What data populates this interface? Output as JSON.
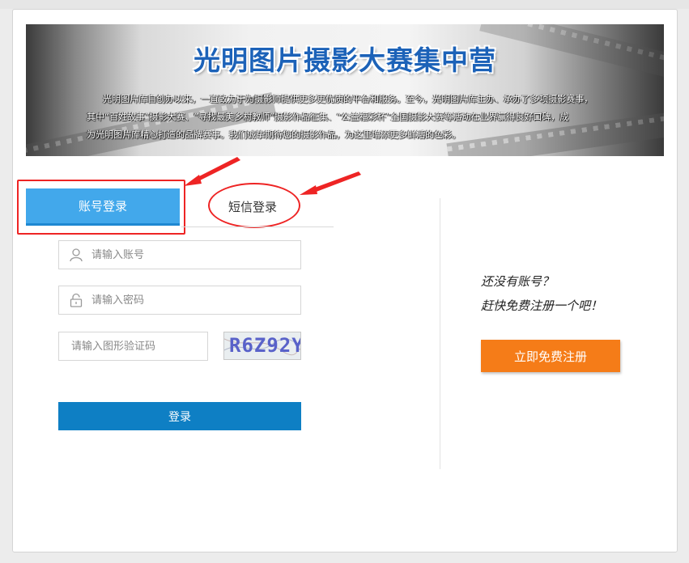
{
  "banner": {
    "title": "光明图片摄影大赛集中营",
    "lines": [
      "光明图片库自创办以来，一直致力于为摄影师提供更多更优质的平台和服务。至今，光明图片库主办、承办了多项摄影赛事，",
      "其中“百姓故事”摄影大赛、“寻找最美乡村教师”摄影作品征集、“公益福彩杯”全国摄影大赛等活动在业界赢得良好口碑，成",
      "为光明图片库精心打造的品牌赛事。我们诚挚期待您的摄影作品，为这里增添更多鲜活的色彩。"
    ]
  },
  "tabs": {
    "account": "账号登录",
    "sms": "短信登录"
  },
  "form": {
    "account_placeholder": "请输入账号",
    "password_placeholder": "请输入密码",
    "captcha_placeholder": "请输入图形验证码",
    "captcha_text": "R6Z92Y",
    "login_label": "登录"
  },
  "register": {
    "no_account": "还没有账号？",
    "prompt": "赶快免费注册一个吧！",
    "button_label": "立即免费注册"
  },
  "colors": {
    "tab_active": "#42a8eb",
    "login_button": "#0e7fc4",
    "register_button": "#f57c18",
    "annotation": "#ee2424"
  }
}
